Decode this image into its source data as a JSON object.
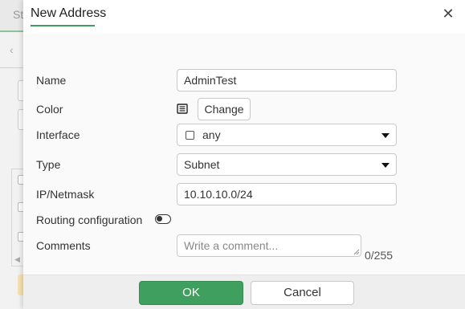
{
  "background": {
    "tab_label": "St"
  },
  "dialog": {
    "title": "New Address",
    "fields": {
      "name": {
        "label": "Name",
        "value": "AdminTest"
      },
      "color": {
        "label": "Color",
        "button": "Change"
      },
      "interface": {
        "label": "Interface",
        "value": "any"
      },
      "type": {
        "label": "Type",
        "value": "Subnet"
      },
      "ip_netmask": {
        "label": "IP/Netmask",
        "value": "10.10.10.0/24"
      },
      "routing": {
        "label": "Routing configuration",
        "enabled": false
      },
      "comments": {
        "label": "Comments",
        "placeholder": "Write a comment...",
        "counter": "0/255"
      }
    },
    "footer": {
      "ok_label": "OK",
      "cancel_label": "Cancel"
    }
  },
  "colors": {
    "accent": "#3f9f5f",
    "footer_bg": "#eeeeee",
    "body_bg": "#fafafa"
  }
}
